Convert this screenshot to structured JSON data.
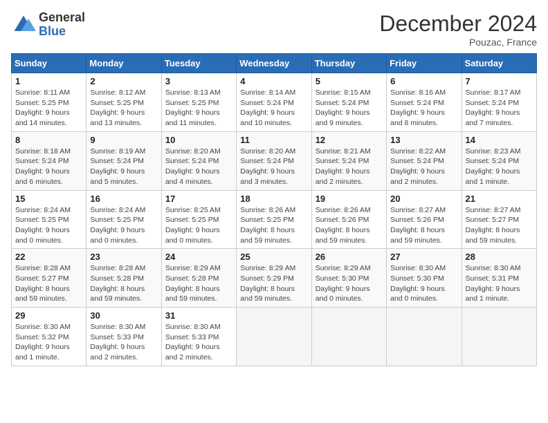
{
  "header": {
    "logo_line1": "General",
    "logo_line2": "Blue",
    "month": "December 2024",
    "location": "Pouzac, France"
  },
  "days_of_week": [
    "Sunday",
    "Monday",
    "Tuesday",
    "Wednesday",
    "Thursday",
    "Friday",
    "Saturday"
  ],
  "weeks": [
    [
      {
        "day": 1,
        "sunrise": "8:11 AM",
        "sunset": "5:25 PM",
        "daylight": "9 hours and 14 minutes."
      },
      {
        "day": 2,
        "sunrise": "8:12 AM",
        "sunset": "5:25 PM",
        "daylight": "9 hours and 13 minutes."
      },
      {
        "day": 3,
        "sunrise": "8:13 AM",
        "sunset": "5:25 PM",
        "daylight": "9 hours and 11 minutes."
      },
      {
        "day": 4,
        "sunrise": "8:14 AM",
        "sunset": "5:24 PM",
        "daylight": "9 hours and 10 minutes."
      },
      {
        "day": 5,
        "sunrise": "8:15 AM",
        "sunset": "5:24 PM",
        "daylight": "9 hours and 9 minutes."
      },
      {
        "day": 6,
        "sunrise": "8:16 AM",
        "sunset": "5:24 PM",
        "daylight": "9 hours and 8 minutes."
      },
      {
        "day": 7,
        "sunrise": "8:17 AM",
        "sunset": "5:24 PM",
        "daylight": "9 hours and 7 minutes."
      }
    ],
    [
      {
        "day": 8,
        "sunrise": "8:18 AM",
        "sunset": "5:24 PM",
        "daylight": "9 hours and 6 minutes."
      },
      {
        "day": 9,
        "sunrise": "8:19 AM",
        "sunset": "5:24 PM",
        "daylight": "9 hours and 5 minutes."
      },
      {
        "day": 10,
        "sunrise": "8:20 AM",
        "sunset": "5:24 PM",
        "daylight": "9 hours and 4 minutes."
      },
      {
        "day": 11,
        "sunrise": "8:20 AM",
        "sunset": "5:24 PM",
        "daylight": "9 hours and 3 minutes."
      },
      {
        "day": 12,
        "sunrise": "8:21 AM",
        "sunset": "5:24 PM",
        "daylight": "9 hours and 2 minutes."
      },
      {
        "day": 13,
        "sunrise": "8:22 AM",
        "sunset": "5:24 PM",
        "daylight": "9 hours and 2 minutes."
      },
      {
        "day": 14,
        "sunrise": "8:23 AM",
        "sunset": "5:24 PM",
        "daylight": "9 hours and 1 minute."
      }
    ],
    [
      {
        "day": 15,
        "sunrise": "8:24 AM",
        "sunset": "5:25 PM",
        "daylight": "9 hours and 0 minutes."
      },
      {
        "day": 16,
        "sunrise": "8:24 AM",
        "sunset": "5:25 PM",
        "daylight": "9 hours and 0 minutes."
      },
      {
        "day": 17,
        "sunrise": "8:25 AM",
        "sunset": "5:25 PM",
        "daylight": "9 hours and 0 minutes."
      },
      {
        "day": 18,
        "sunrise": "8:26 AM",
        "sunset": "5:25 PM",
        "daylight": "8 hours and 59 minutes."
      },
      {
        "day": 19,
        "sunrise": "8:26 AM",
        "sunset": "5:26 PM",
        "daylight": "8 hours and 59 minutes."
      },
      {
        "day": 20,
        "sunrise": "8:27 AM",
        "sunset": "5:26 PM",
        "daylight": "8 hours and 59 minutes."
      },
      {
        "day": 21,
        "sunrise": "8:27 AM",
        "sunset": "5:27 PM",
        "daylight": "8 hours and 59 minutes."
      }
    ],
    [
      {
        "day": 22,
        "sunrise": "8:28 AM",
        "sunset": "5:27 PM",
        "daylight": "8 hours and 59 minutes."
      },
      {
        "day": 23,
        "sunrise": "8:28 AM",
        "sunset": "5:28 PM",
        "daylight": "8 hours and 59 minutes."
      },
      {
        "day": 24,
        "sunrise": "8:29 AM",
        "sunset": "5:28 PM",
        "daylight": "8 hours and 59 minutes."
      },
      {
        "day": 25,
        "sunrise": "8:29 AM",
        "sunset": "5:29 PM",
        "daylight": "8 hours and 59 minutes."
      },
      {
        "day": 26,
        "sunrise": "8:29 AM",
        "sunset": "5:30 PM",
        "daylight": "9 hours and 0 minutes."
      },
      {
        "day": 27,
        "sunrise": "8:30 AM",
        "sunset": "5:30 PM",
        "daylight": "9 hours and 0 minutes."
      },
      {
        "day": 28,
        "sunrise": "8:30 AM",
        "sunset": "5:31 PM",
        "daylight": "9 hours and 1 minute."
      }
    ],
    [
      {
        "day": 29,
        "sunrise": "8:30 AM",
        "sunset": "5:32 PM",
        "daylight": "9 hours and 1 minute."
      },
      {
        "day": 30,
        "sunrise": "8:30 AM",
        "sunset": "5:33 PM",
        "daylight": "9 hours and 2 minutes."
      },
      {
        "day": 31,
        "sunrise": "8:30 AM",
        "sunset": "5:33 PM",
        "daylight": "9 hours and 2 minutes."
      },
      null,
      null,
      null,
      null
    ]
  ]
}
